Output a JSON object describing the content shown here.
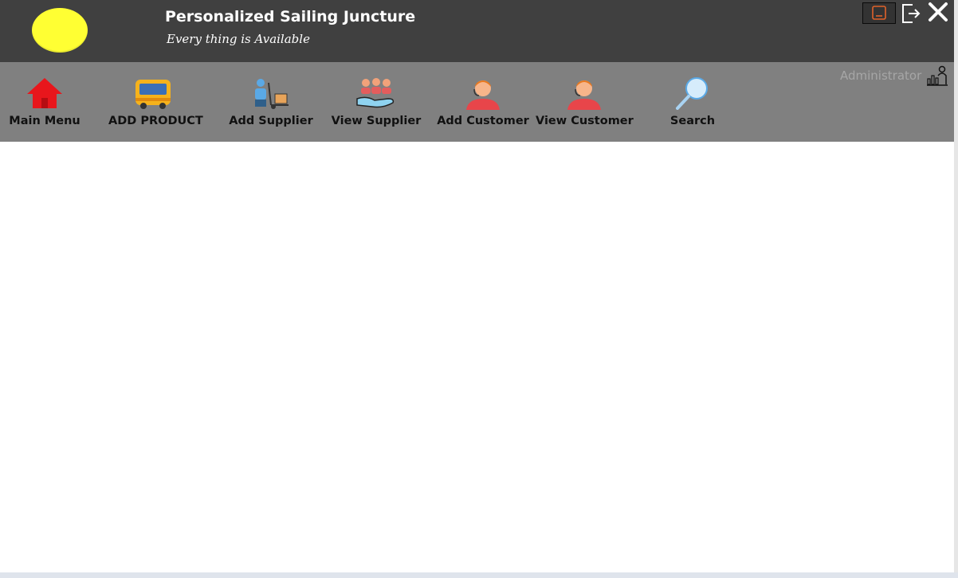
{
  "app": {
    "title": "Personalized Sailing Juncture",
    "subtitle": "Every thing is Available"
  },
  "colors": {
    "header_bg": "#404040",
    "toolbar_bg": "#808080",
    "logo": "#ffff33",
    "content_bg": "#ffffff"
  },
  "toolbar": {
    "items": [
      {
        "label": "Main Menu",
        "icon": "home-icon"
      },
      {
        "label": "ADD PRODUCT",
        "icon": "bus-icon"
      },
      {
        "label": "Add Supplier",
        "icon": "supplier-icon"
      },
      {
        "label": "View Supplier",
        "icon": "group-hand-icon"
      },
      {
        "label": "Add Customer",
        "icon": "customer-support-icon"
      },
      {
        "label": "View Customer",
        "icon": "customer-support-icon"
      },
      {
        "label": "Search",
        "icon": "magnifier-icon"
      }
    ]
  },
  "user": {
    "role": "Administrator",
    "icon": "admin-chart-icon"
  },
  "window_controls": {
    "minimize_icon": "minimize-icon",
    "exit_icon": "logout-icon",
    "close_icon": "close-icon"
  }
}
